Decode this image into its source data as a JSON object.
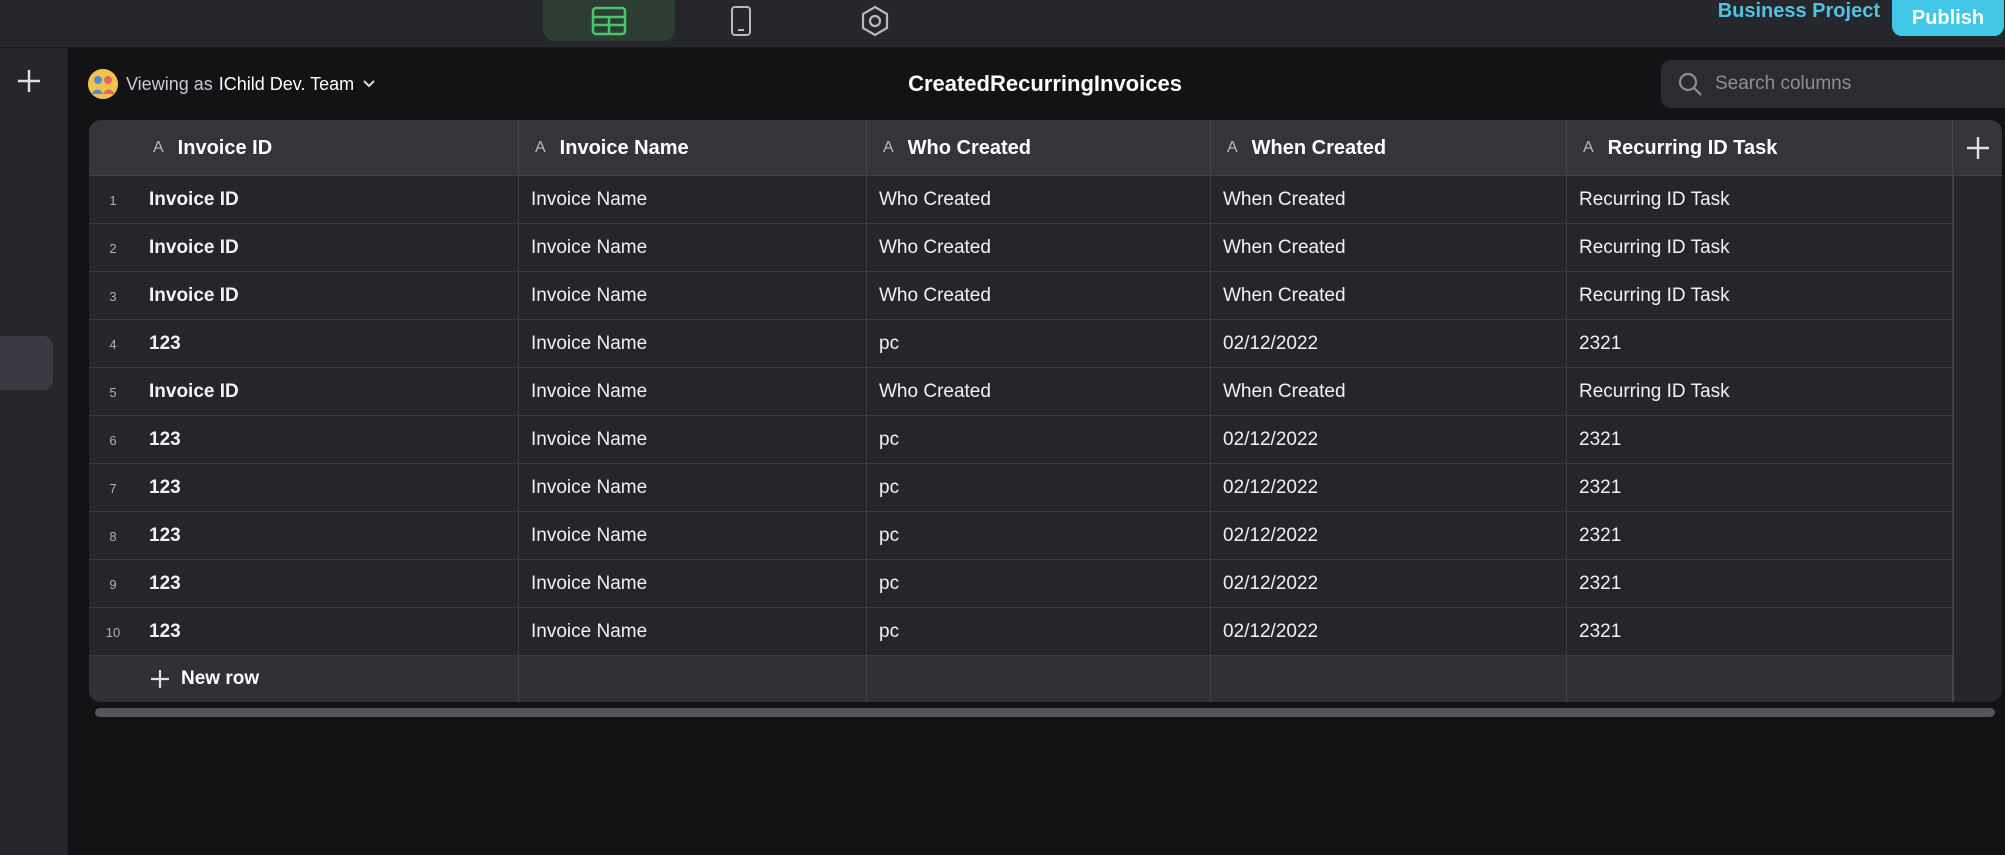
{
  "topbar": {
    "modes": [
      {
        "name": "data-icon",
        "active": true
      },
      {
        "name": "phone-icon",
        "active": false
      },
      {
        "name": "settings-icon",
        "active": false
      }
    ],
    "project_name": "Business Project",
    "publish_label": "Publish"
  },
  "header": {
    "viewing_label": "Viewing as",
    "viewing_team": "IChild Dev. Team",
    "title": "CreatedRecurringInvoices",
    "search_placeholder": "Search columns"
  },
  "table": {
    "columns": [
      {
        "label": "Invoice ID",
        "type_icon": "A"
      },
      {
        "label": "Invoice Name",
        "type_icon": "A"
      },
      {
        "label": "Who Created",
        "type_icon": "A"
      },
      {
        "label": "When Created",
        "type_icon": "A"
      },
      {
        "label": "Recurring ID Task",
        "type_icon": "A"
      }
    ],
    "rows": [
      {
        "num": "1",
        "cells": [
          "Invoice ID",
          "Invoice Name",
          "Who Created",
          "When Created",
          "Recurring ID Task"
        ]
      },
      {
        "num": "2",
        "cells": [
          "Invoice ID",
          "Invoice Name",
          "Who Created",
          "When Created",
          "Recurring ID Task"
        ]
      },
      {
        "num": "3",
        "cells": [
          "Invoice ID",
          "Invoice Name",
          "Who Created",
          "When Created",
          "Recurring ID Task"
        ]
      },
      {
        "num": "4",
        "cells": [
          "123",
          "Invoice Name",
          "pc",
          "02/12/2022",
          "2321"
        ]
      },
      {
        "num": "5",
        "cells": [
          "Invoice ID",
          "Invoice Name",
          "Who Created",
          "When Created",
          "Recurring ID Task"
        ]
      },
      {
        "num": "6",
        "cells": [
          "123",
          "Invoice Name",
          "pc",
          "02/12/2022",
          "2321"
        ]
      },
      {
        "num": "7",
        "cells": [
          "123",
          "Invoice Name",
          "pc",
          "02/12/2022",
          "2321"
        ]
      },
      {
        "num": "8",
        "cells": [
          "123",
          "Invoice Name",
          "pc",
          "02/12/2022",
          "2321"
        ]
      },
      {
        "num": "9",
        "cells": [
          "123",
          "Invoice Name",
          "pc",
          "02/12/2022",
          "2321"
        ]
      },
      {
        "num": "10",
        "cells": [
          "123",
          "Invoice Name",
          "pc",
          "02/12/2022",
          "2321"
        ]
      }
    ],
    "new_row_label": "New row"
  },
  "colors": {
    "accent": "#42c7e8",
    "data_tab_icon": "#4cc46e"
  }
}
